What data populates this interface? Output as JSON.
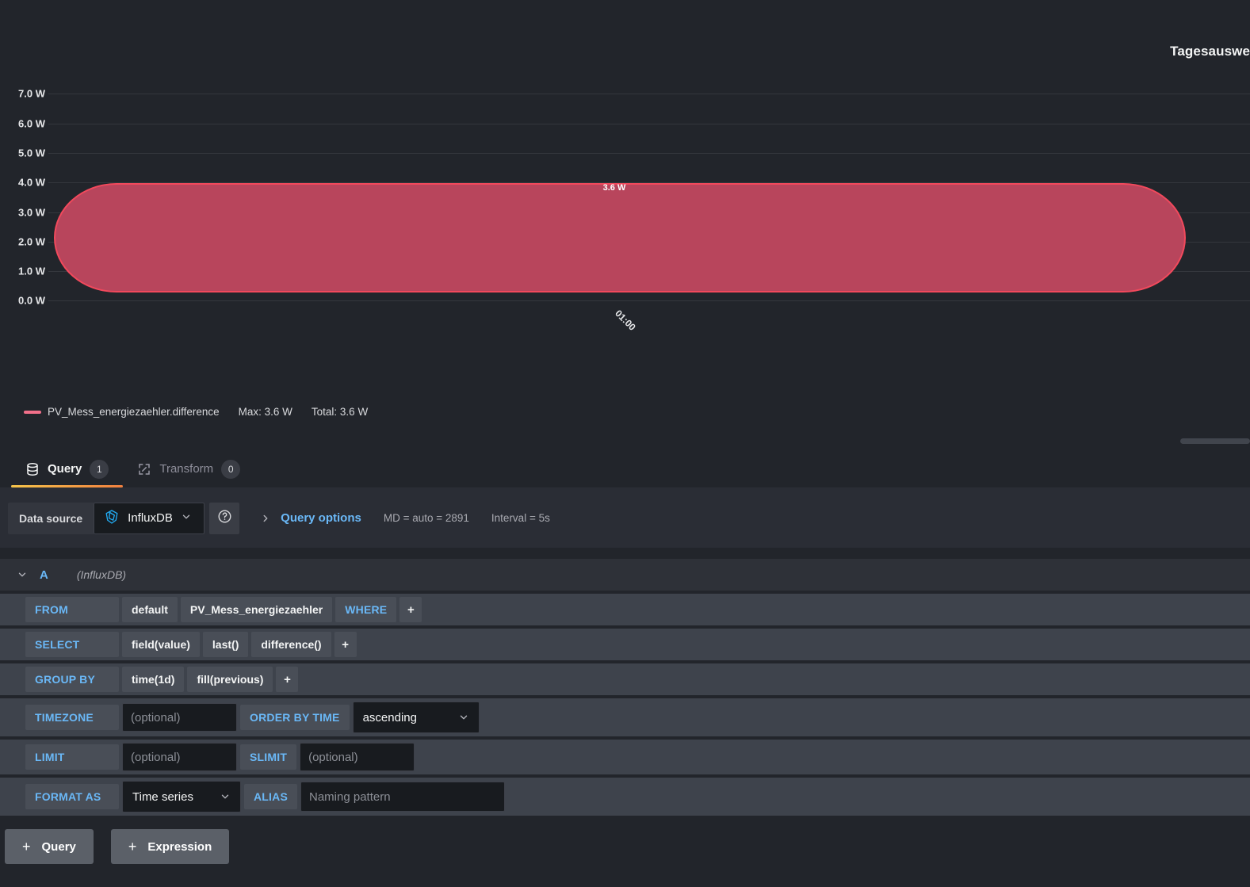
{
  "panel": {
    "title": "Tagesauswe",
    "legend": {
      "series_name": "PV_Mess_energiezaehler.difference",
      "max": "Max: 3.6 W",
      "total": "Total: 3.6 W",
      "swatch_color": "#f2708a"
    }
  },
  "chart_data": {
    "type": "bar",
    "title": "Tagesauswe",
    "categories": [
      "01:00"
    ],
    "values": [
      3.6
    ],
    "value_labels": [
      "3.6 W"
    ],
    "series": [
      {
        "name": "PV_Mess_energiezaehler.difference",
        "values": [
          3.6
        ],
        "color": "#f2495c",
        "fill_color": "#b8455c"
      }
    ],
    "xlabel": "",
    "ylabel": "",
    "unit": "W",
    "ylim": [
      0,
      7
    ],
    "ytick_labels": [
      "7.0 W",
      "6.0 W",
      "5.0 W",
      "4.0 W",
      "3.0 W",
      "2.0 W",
      "1.0 W",
      "0.0 W"
    ],
    "ytick_values": [
      7,
      6,
      5,
      4,
      3,
      2,
      1,
      0
    ],
    "xtick_labels": [
      "01:00"
    ],
    "grid": true,
    "legend_position": "bottom",
    "legend_stats": {
      "Max": "3.6 W",
      "Total": "3.6 W"
    }
  },
  "tabs": [
    {
      "label": "Query",
      "badge": "1",
      "icon": "database-icon",
      "active": true
    },
    {
      "label": "Transform",
      "badge": "0",
      "icon": "transform-icon",
      "active": false
    }
  ],
  "datasource_bar": {
    "label": "Data source",
    "picker_value": "InfluxDB",
    "picker_icon": "influxdb-icon",
    "help_icon": "help-circle-icon",
    "query_options_label": "Query options",
    "max_data_points": "MD = auto = 2891",
    "interval": "Interval = 5s"
  },
  "query": {
    "ref_id": "A",
    "datasource": "(InfluxDB)",
    "rows": {
      "from": {
        "key": "FROM",
        "policy": "default",
        "measurement": "PV_Mess_energiezaehler",
        "where_key": "WHERE",
        "add": "+"
      },
      "select": {
        "key": "SELECT",
        "parts": [
          "field(value)",
          "last()",
          "difference()"
        ],
        "add": "+"
      },
      "group_by": {
        "key": "GROUP BY",
        "parts": [
          "time(1d)",
          "fill(previous)"
        ],
        "add": "+"
      },
      "timezone": {
        "key": "TIMEZONE",
        "placeholder": "(optional)",
        "value": ""
      },
      "order_by_time": {
        "key": "ORDER BY TIME",
        "value": "ascending"
      },
      "limit": {
        "key": "LIMIT",
        "placeholder": "(optional)",
        "value": ""
      },
      "slimit": {
        "key": "SLIMIT",
        "placeholder": "(optional)",
        "value": ""
      },
      "format_as": {
        "key": "FORMAT AS",
        "value": "Time series"
      },
      "alias": {
        "key": "ALIAS",
        "placeholder": "Naming pattern",
        "value": ""
      }
    }
  },
  "footer": {
    "add_query": "Query",
    "add_expression": "Expression",
    "plus": "+"
  }
}
